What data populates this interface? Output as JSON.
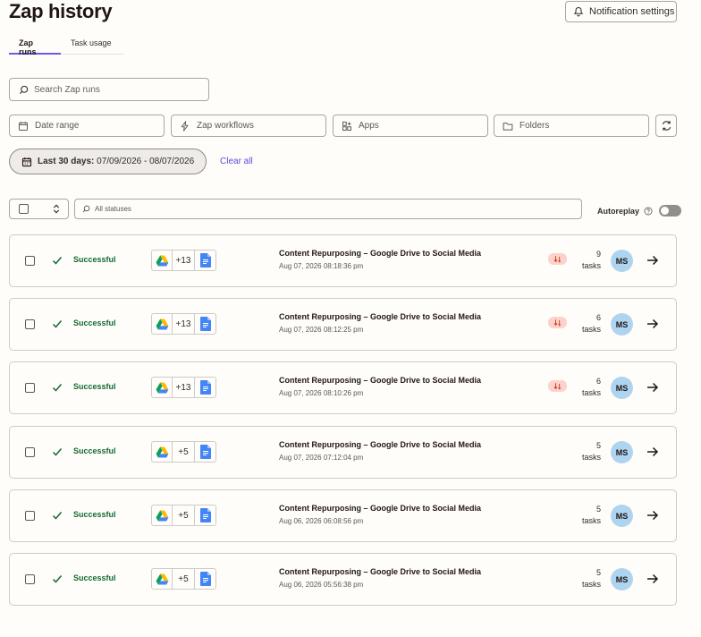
{
  "header": {
    "title": "Zap history",
    "notification_button": "Notification settings"
  },
  "tabs": [
    {
      "label": "Zap runs",
      "active": true
    },
    {
      "label": "Task usage",
      "active": false
    }
  ],
  "search": {
    "placeholder": "Search Zap runs"
  },
  "filters": {
    "date_range": "Date range",
    "zap_workflows": "Zap workflows",
    "apps": "Apps",
    "folders": "Folders"
  },
  "active_filter": {
    "label": "Last 30 days:",
    "range": "07/09/2026 - 08/07/2026",
    "clear": "Clear all"
  },
  "toolbar": {
    "status_placeholder": "All statuses",
    "autoreplay_label": "Autoreplay",
    "autoreplay_on": false
  },
  "runs": [
    {
      "status": "Successful",
      "extra_apps": "+13",
      "name": "Content Repurposing – Google Drive to Social Media",
      "date": "Aug 07, 2026 08:18:36 pm",
      "replay": true,
      "tasks": "9",
      "tasks_label": "tasks",
      "owner": "MS"
    },
    {
      "status": "Successful",
      "extra_apps": "+13",
      "name": "Content Repurposing – Google Drive to Social Media",
      "date": "Aug 07, 2026 08:12:25 pm",
      "replay": true,
      "tasks": "6",
      "tasks_label": "tasks",
      "owner": "MS"
    },
    {
      "status": "Successful",
      "extra_apps": "+13",
      "name": "Content Repurposing – Google Drive to Social Media",
      "date": "Aug 07, 2026 08:10:26 pm",
      "replay": true,
      "tasks": "6",
      "tasks_label": "tasks",
      "owner": "MS"
    },
    {
      "status": "Successful",
      "extra_apps": "+5",
      "name": "Content Repurposing – Google Drive to Social Media",
      "date": "Aug 07, 2026 07:12:04 pm",
      "replay": false,
      "tasks": "5",
      "tasks_label": "tasks",
      "owner": "MS"
    },
    {
      "status": "Successful",
      "extra_apps": "+5",
      "name": "Content Repurposing – Google Drive to Social Media",
      "date": "Aug 06, 2026 06:08:56 pm",
      "replay": false,
      "tasks": "5",
      "tasks_label": "tasks",
      "owner": "MS"
    },
    {
      "status": "Successful",
      "extra_apps": "+5",
      "name": "Content Repurposing – Google Drive to Social Media",
      "date": "Aug 06, 2026 05:56:38 pm",
      "replay": false,
      "tasks": "5",
      "tasks_label": "tasks",
      "owner": "MS"
    }
  ],
  "colors": {
    "accent": "#695be8",
    "success": "#136a33",
    "avatar_bg": "#aed4f0",
    "replay_badge": "#fcd3cc"
  }
}
